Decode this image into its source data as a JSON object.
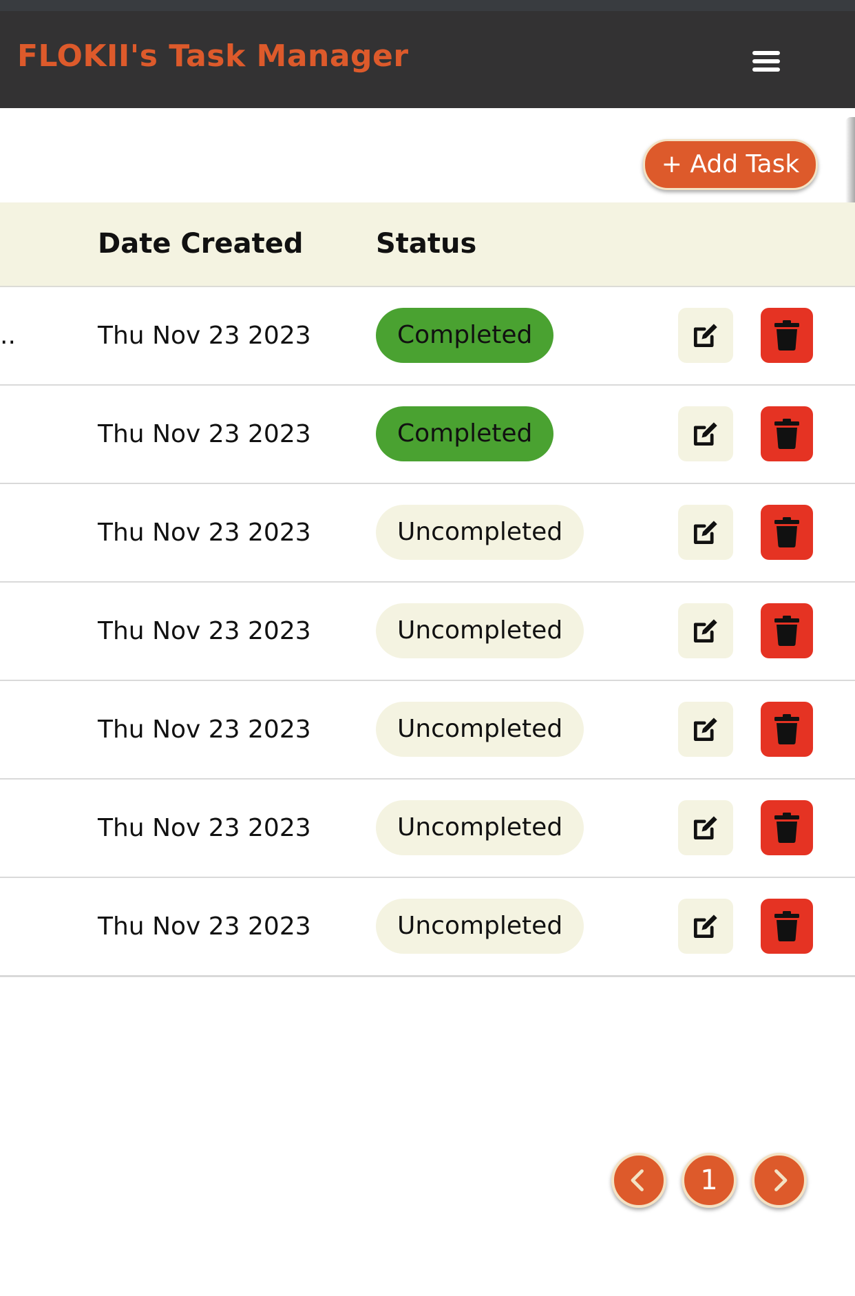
{
  "header": {
    "title": "FLOKII's Task Manager",
    "menu_icon": "hamburger-menu-icon"
  },
  "toolbar": {
    "add_task_label": "+ Add Task"
  },
  "table": {
    "columns": [
      "Date Created",
      "Status"
    ],
    "rows": [
      {
        "title_fragment": "..",
        "date": "Thu Nov 23 2023",
        "status": "Completed"
      },
      {
        "date": "Thu Nov 23 2023",
        "status": "Completed"
      },
      {
        "date": "Thu Nov 23 2023",
        "status": "Uncompleted"
      },
      {
        "date": "Thu Nov 23 2023",
        "status": "Uncompleted"
      },
      {
        "date": "Thu Nov 23 2023",
        "status": "Uncompleted"
      },
      {
        "date": "Thu Nov 23 2023",
        "status": "Uncompleted"
      },
      {
        "date": "Thu Nov 23 2023",
        "status": "Uncompleted"
      }
    ],
    "row_icons": {
      "edit": "edit-pencil-icon",
      "delete": "trash-icon"
    }
  },
  "pagination": {
    "current_page": "1",
    "prev_icon": "chevron-left-icon",
    "next_icon": "chevron-right-icon"
  },
  "colors": {
    "accent": "#dd5a2b",
    "header_bg": "#333233",
    "table_header_bg": "#f4f3e1",
    "completed": "#4aa231",
    "uncompleted": "#f4f3e1",
    "delete": "#e53323"
  }
}
